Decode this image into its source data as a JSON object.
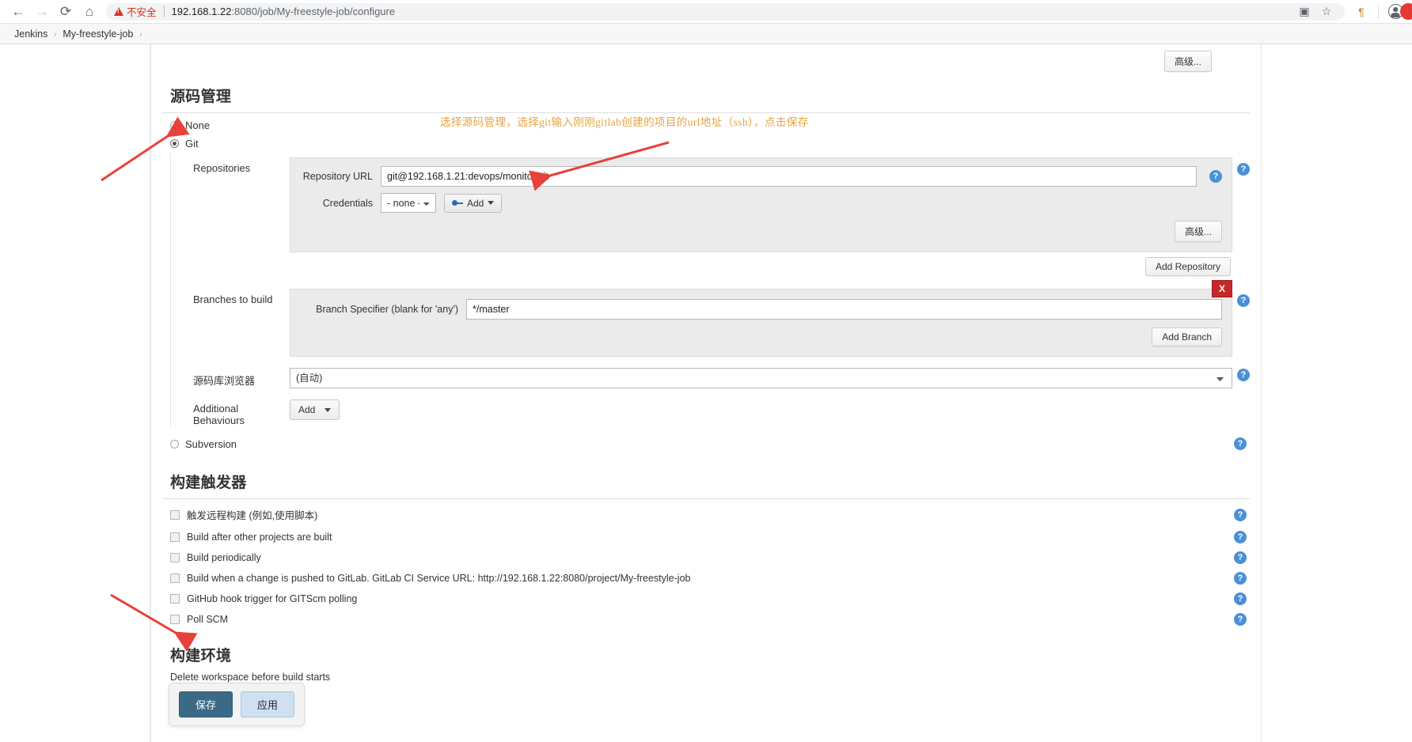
{
  "browser": {
    "back_icon": "back-arrow-icon",
    "forward_icon": "forward-arrow-icon",
    "reload_icon": "reload-icon",
    "home_icon": "home-icon",
    "security_warning": "不安全",
    "url_host": "192.168.1.22",
    "url_rest": ":8080/job/My-freestyle-job/configure",
    "translate_icon": "translate-icon",
    "bookmark_icon": "star-bookmark-icon",
    "extension_icon": "pilcrow-extension-icon",
    "profile_icon": "profile-avatar-icon"
  },
  "breadcrumb": {
    "items": [
      "Jenkins",
      "My-freestyle-job"
    ],
    "separator": "›"
  },
  "top": {
    "advanced_label": "高级..."
  },
  "scm": {
    "heading": "源码管理",
    "options": [
      {
        "label": "None",
        "selected": false
      },
      {
        "label": "Git",
        "selected": true
      },
      {
        "label": "Subversion",
        "selected": false
      }
    ],
    "repositories": {
      "label": "Repositories",
      "repository_url_label": "Repository URL",
      "repository_url_value": "git@192.168.1.21:devops/monitor.git",
      "credentials_label": "Credentials",
      "credentials_value": "- none -",
      "credentials_options": [
        "- none -"
      ],
      "add_credentials_label": "Add",
      "advanced_label": "高级...",
      "add_repository_label": "Add Repository"
    },
    "branches": {
      "label": "Branches to build",
      "specifier_label": "Branch Specifier (blank for 'any')",
      "specifier_value": "*/master",
      "delete_label": "X",
      "add_branch_label": "Add Branch"
    },
    "browser": {
      "label": "源码库浏览器",
      "value": "(自动)",
      "options": [
        "(自动)"
      ]
    },
    "additional": {
      "label": "Additional Behaviours",
      "add_label": "Add"
    }
  },
  "triggers": {
    "heading": "构建触发器",
    "items": [
      {
        "label": "触发远程构建 (例如,使用脚本)",
        "checked": false
      },
      {
        "label": "Build after other projects are built",
        "checked": false
      },
      {
        "label": "Build periodically",
        "checked": false
      },
      {
        "label": "Build when a change is pushed to GitLab. GitLab CI Service URL: http://192.168.1.22:8080/project/My-freestyle-job",
        "checked": false
      },
      {
        "label": "GitHub hook trigger for GITScm polling",
        "checked": false
      },
      {
        "label": "Poll SCM",
        "checked": false
      }
    ]
  },
  "build_env": {
    "heading": "构建环境",
    "sub": "Delete workspace before build starts"
  },
  "save_bar": {
    "save_label": "保存",
    "apply_label": "应用"
  },
  "annotations": {
    "main_note": "选择源码管理，选择git输入刚刚gitlab创建的项目的url地址（ssh），点击保存",
    "note_color": "#E8A33D",
    "arrow_color": "#E8413C"
  }
}
